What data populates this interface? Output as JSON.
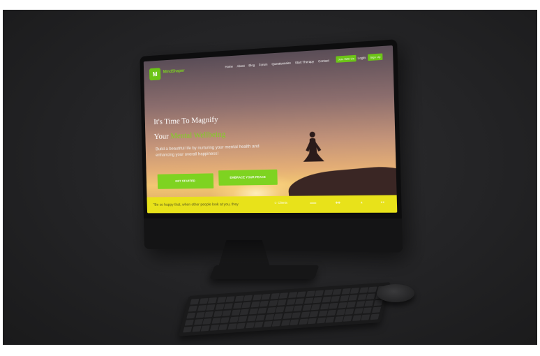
{
  "site": {
    "brand": "MindShaper",
    "nav": [
      "Home",
      "About",
      "Blog",
      "Forum",
      "Questionnaire",
      "Start Therapy",
      "Contact"
    ],
    "join_button": "Join With Us",
    "login_label": "Login",
    "signup_button": "Sign Up",
    "hero": {
      "title_line1": "It's Time To Magnify",
      "title_line2_prefix": "Your ",
      "title_line2_accent": "Mental Wellbeing",
      "subtitle": "Build a beautiful life by nurturing your mental health and enhancing your overall happiness!",
      "cta_primary": "GET STARTED",
      "cta_secondary": "EMBRACE YOUR PEACE"
    },
    "band": {
      "quote": "\"Be so happy that, when other people look at you, they",
      "clients_label": "Clients"
    }
  },
  "colors": {
    "accent": "#7ed321",
    "band": "#e8e21a",
    "background": "#232325"
  }
}
